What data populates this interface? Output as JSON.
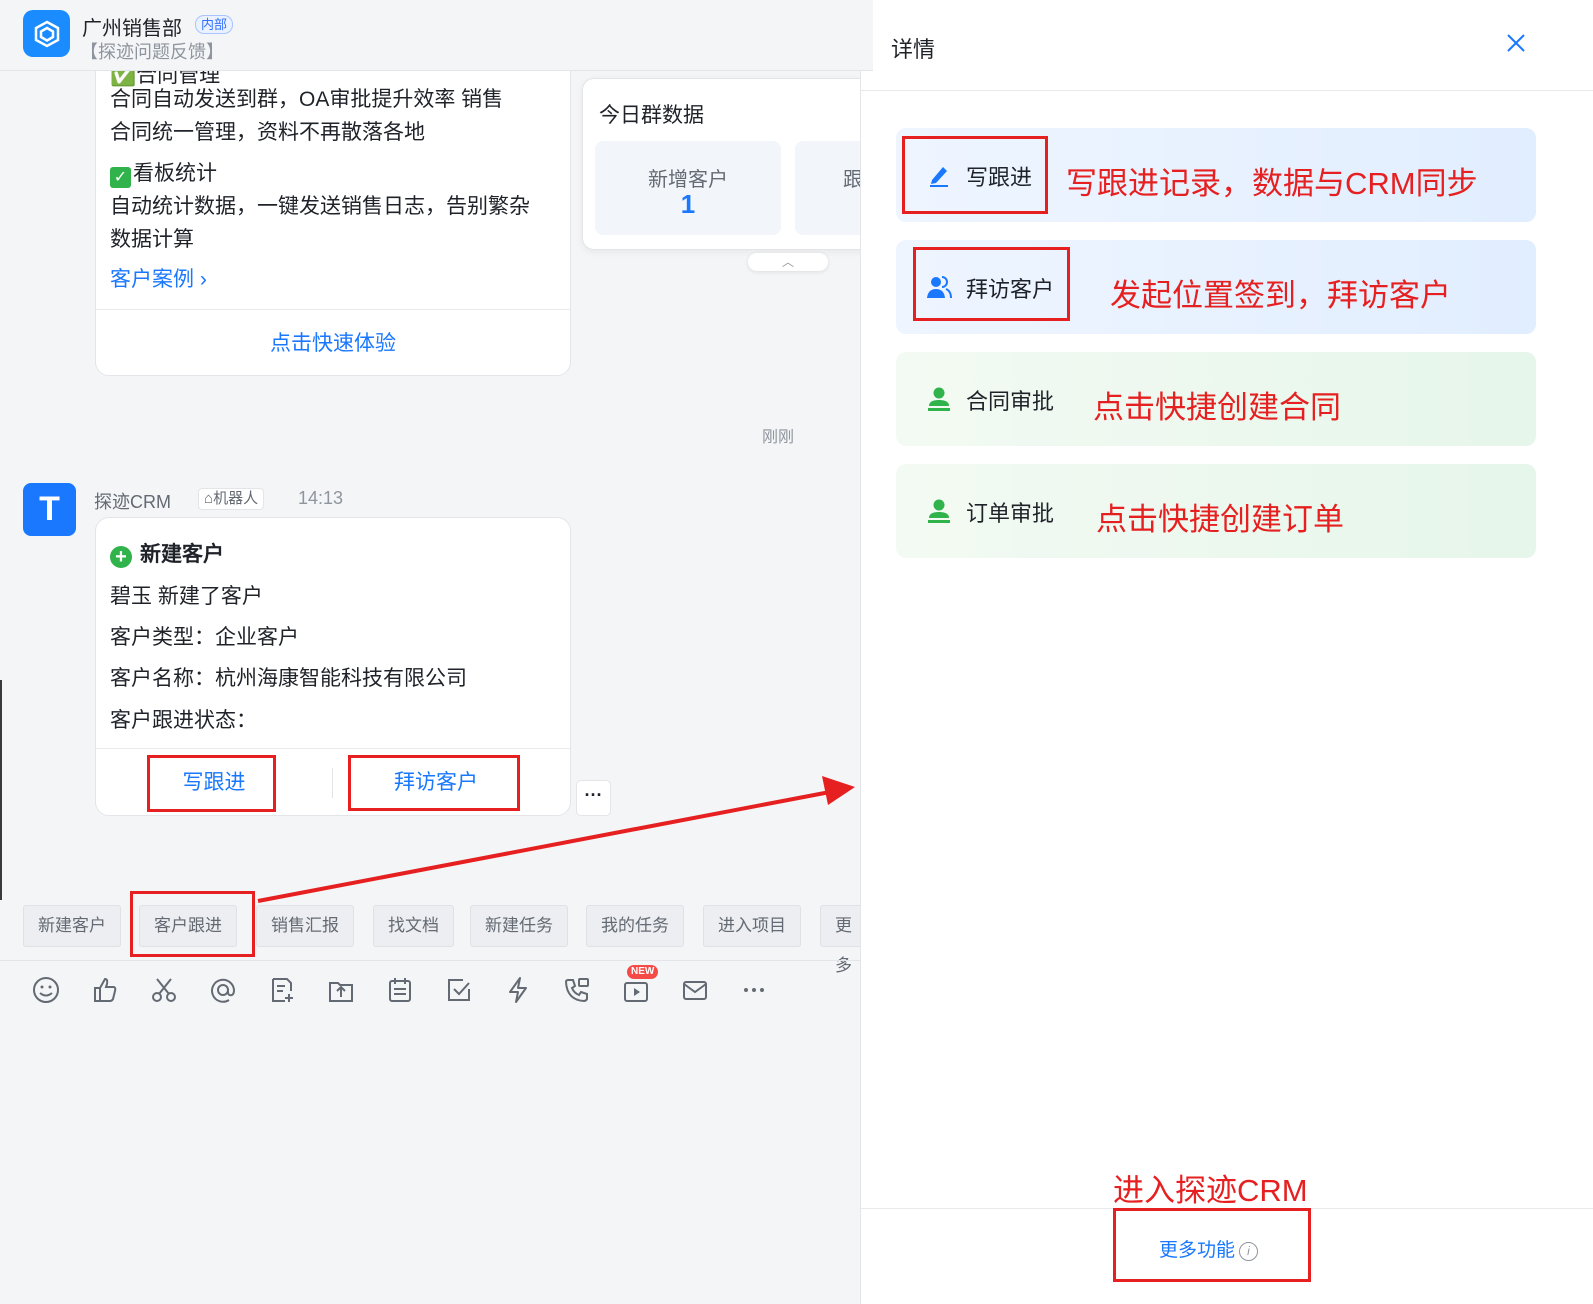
{
  "header": {
    "group_name": "广州销售部",
    "group_tag": "内部",
    "group_sub": "【探迹问题反馈】"
  },
  "card1": {
    "partial_heading": "✅合同管理",
    "line1": "合同自动发送到群，OA审批提升效率  销售",
    "line2": "合同统一管理，资料不再散落各地",
    "section2_title": "看板统计",
    "line3": "自动统计数据，一键发送销售日志，告别繁杂",
    "line4": "数据计算",
    "case_link": "客户案例",
    "try_link": "点击快速体验"
  },
  "stats_card": {
    "title": "今日群数据",
    "items": [
      {
        "label": "新增客户",
        "value": "1"
      },
      {
        "label": "跟",
        "value": ""
      }
    ]
  },
  "message_time": "刚刚",
  "bot": {
    "avatar_letter": "T",
    "name": "探迹CRM",
    "tag": "机器人",
    "time": "14:13"
  },
  "card2": {
    "title": "新建客户",
    "line1": "碧玉 新建了客户",
    "line2": "客户类型：企业客户",
    "line3": "客户名称：杭州海康智能科技有限公司",
    "line4": "客户跟进状态：",
    "btn_follow": "写跟进",
    "btn_visit": "拜访客户",
    "more": "···"
  },
  "quick_chips": [
    "新建客户",
    "客户跟进",
    "销售汇报",
    "找文档",
    "新建任务",
    "我的任务",
    "进入项目",
    "更多"
  ],
  "toolbar_icons": [
    "emoji-icon",
    "thumbs-up-icon",
    "scissors-icon",
    "at-icon",
    "doc-add-icon",
    "upload-icon",
    "calendar-icon",
    "checkbox-icon",
    "lightning-icon",
    "phone-icon",
    "video-icon",
    "mail-icon",
    "more-icon"
  ],
  "toolbar_badge": "NEW",
  "panel": {
    "title": "详情",
    "actions": [
      {
        "label": "写跟进",
        "note": "写跟进记录，数据与CRM同步",
        "icon": "pen-icon"
      },
      {
        "label": "拜访客户",
        "note": "发起位置签到，拜访客户",
        "icon": "users-icon"
      },
      {
        "label": "合同审批",
        "note": "点击快捷创建合同",
        "icon": "stamp-icon"
      },
      {
        "label": "订单审批",
        "note": "点击快捷创建订单",
        "icon": "stamp-icon"
      }
    ],
    "footer_note": "进入探迹CRM",
    "footer_link": "更多功能",
    "info_glyph": "i"
  },
  "colors": {
    "accent": "#1a78ff",
    "annotation_red": "#e62020",
    "success_green": "#2fb34a"
  }
}
